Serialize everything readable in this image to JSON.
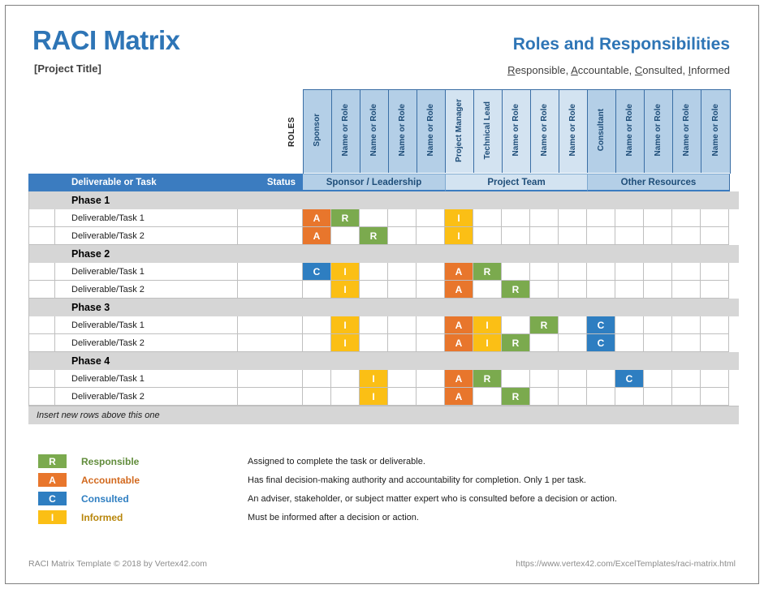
{
  "header": {
    "title": "RACI Matrix",
    "project_title": "[Project Title]",
    "right_title": "Roles and Responsibilities",
    "right_subtitle_parts": [
      {
        "initial": "R",
        "rest": "esponsible, "
      },
      {
        "initial": "A",
        "rest": "ccountable, "
      },
      {
        "initial": "C",
        "rest": "onsulted, "
      },
      {
        "initial": "I",
        "rest": "nformed"
      }
    ]
  },
  "matrix": {
    "roles_axis_label": "ROLES",
    "task_column_header": "Deliverable or Task",
    "status_column_header": "Status",
    "role_columns": [
      {
        "label": "Sponsor",
        "group": 0
      },
      {
        "label": "Name or Role",
        "group": 0
      },
      {
        "label": "Name or Role",
        "group": 0
      },
      {
        "label": "Name or Role",
        "group": 0
      },
      {
        "label": "Name or Role",
        "group": 0
      },
      {
        "label": "Project Manager",
        "group": 1
      },
      {
        "label": "Technical Lead",
        "group": 1
      },
      {
        "label": "Name or Role",
        "group": 1
      },
      {
        "label": "Name or Role",
        "group": 1
      },
      {
        "label": "Name or Role",
        "group": 1
      },
      {
        "label": "Consultant",
        "group": 2
      },
      {
        "label": "Name or Role",
        "group": 2
      },
      {
        "label": "Name or Role",
        "group": 2
      },
      {
        "label": "Name or Role",
        "group": 2
      },
      {
        "label": "Name or Role",
        "group": 2
      }
    ],
    "role_groups": [
      {
        "label": "Sponsor / Leadership",
        "span": 5
      },
      {
        "label": "Project Team",
        "span": 5
      },
      {
        "label": "Other Resources",
        "span": 5
      }
    ],
    "rows": [
      {
        "type": "phase",
        "label": "Phase 1",
        "status": "",
        "cells": [
          "",
          "",
          "",
          "",
          "",
          "",
          "",
          "",
          "",
          "",
          "",
          "",
          "",
          "",
          ""
        ]
      },
      {
        "type": "task",
        "label": "Deliverable/Task 1",
        "status": "",
        "cells": [
          "A",
          "R",
          "",
          "",
          "",
          "I",
          "",
          "",
          "",
          "",
          "",
          "",
          "",
          "",
          ""
        ]
      },
      {
        "type": "task",
        "label": "Deliverable/Task 2",
        "status": "",
        "cells": [
          "A",
          "",
          "R",
          "",
          "",
          "I",
          "",
          "",
          "",
          "",
          "",
          "",
          "",
          "",
          ""
        ]
      },
      {
        "type": "phase",
        "label": "Phase 2",
        "status": "",
        "cells": [
          "",
          "",
          "",
          "",
          "",
          "",
          "",
          "",
          "",
          "",
          "",
          "",
          "",
          "",
          ""
        ]
      },
      {
        "type": "task",
        "label": "Deliverable/Task 1",
        "status": "",
        "cells": [
          "C",
          "I",
          "",
          "",
          "",
          "A",
          "R",
          "",
          "",
          "",
          "",
          "",
          "",
          "",
          ""
        ]
      },
      {
        "type": "task",
        "label": "Deliverable/Task 2",
        "status": "",
        "cells": [
          "",
          "I",
          "",
          "",
          "",
          "A",
          "",
          "R",
          "",
          "",
          "",
          "",
          "",
          "",
          ""
        ]
      },
      {
        "type": "phase",
        "label": "Phase 3",
        "status": "",
        "cells": [
          "",
          "",
          "",
          "",
          "",
          "",
          "",
          "",
          "",
          "",
          "",
          "",
          "",
          "",
          ""
        ]
      },
      {
        "type": "task",
        "label": "Deliverable/Task 1",
        "status": "",
        "cells": [
          "",
          "I",
          "",
          "",
          "",
          "A",
          "I",
          "",
          "R",
          "",
          "C",
          "",
          "",
          "",
          ""
        ]
      },
      {
        "type": "task",
        "label": "Deliverable/Task 2",
        "status": "",
        "cells": [
          "",
          "I",
          "",
          "",
          "",
          "A",
          "I",
          "R",
          "",
          "",
          "C",
          "",
          "",
          "",
          ""
        ]
      },
      {
        "type": "phase",
        "label": "Phase 4",
        "status": "",
        "cells": [
          "",
          "",
          "",
          "",
          "",
          "",
          "",
          "",
          "",
          "",
          "",
          "",
          "",
          "",
          ""
        ]
      },
      {
        "type": "task",
        "label": "Deliverable/Task 1",
        "status": "",
        "cells": [
          "",
          "",
          "I",
          "",
          "",
          "A",
          "R",
          "",
          "",
          "",
          "",
          "C",
          "",
          "",
          ""
        ]
      },
      {
        "type": "task",
        "label": "Deliverable/Task 2",
        "status": "",
        "cells": [
          "",
          "",
          "I",
          "",
          "",
          "A",
          "",
          "R",
          "",
          "",
          "",
          "",
          "",
          "",
          ""
        ]
      }
    ],
    "insert_note": "Insert new rows above this one"
  },
  "legend": [
    {
      "code": "R",
      "name": "Responsible",
      "description": "Assigned to complete the task or deliverable."
    },
    {
      "code": "A",
      "name": "Accountable",
      "description": "Has final decision-making authority and accountability for completion. Only 1 per task."
    },
    {
      "code": "C",
      "name": "Consulted",
      "description": "An adviser, stakeholder, or subject matter expert who is consulted before a decision or action."
    },
    {
      "code": "I",
      "name": "Informed",
      "description": "Must be informed after a decision or action."
    }
  ],
  "footer": {
    "left": "RACI Matrix Template © 2018 by Vertex42.com",
    "right": "https://www.vertex42.com/ExcelTemplates/raci-matrix.html"
  },
  "colors": {
    "responsible": "#7BAA4E",
    "accountable": "#E8762C",
    "consulted": "#2E7EC1",
    "informed": "#FBBF15",
    "brand_blue": "#2E75B6",
    "band_blue": "#3B7CC0",
    "group_dark": "#B4CFE7",
    "group_light": "#D3E3F1",
    "phase_gray": "#D6D6D6"
  }
}
